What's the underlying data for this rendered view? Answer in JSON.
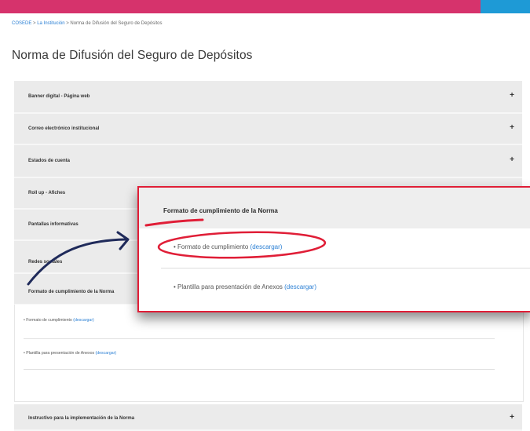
{
  "header": {
    "brand_color": "#d6336c",
    "accent_color": "#1e9ad6"
  },
  "breadcrumb": {
    "home": "COSEDE",
    "sep1": " > ",
    "section": "La Institución",
    "sep2": " > ",
    "current": "Norma de Difusión del Seguro de Depósitos"
  },
  "page_title": "Norma de Difusión del Seguro de Depósitos",
  "accordion": {
    "items": [
      {
        "label": "Banner digital - Página web",
        "icon": "+"
      },
      {
        "label": "Correo electrónico institucional",
        "icon": "+"
      },
      {
        "label": "Estados de cuenta",
        "icon": "+"
      },
      {
        "label": "Roll up - Afiches"
      },
      {
        "label": "Pantallas informativas"
      },
      {
        "label": "Redes sociales"
      },
      {
        "label": "Formato de cumplimiento de la Norma"
      },
      {
        "label": "Instructivo para la implementación de la Norma",
        "icon": "+"
      }
    ],
    "open_item": {
      "rows": [
        {
          "text": "Formato de cumplimiento",
          "link": "(descargar)"
        },
        {
          "text": "Plantilla para presentación de Anexos",
          "link": "(descargar)"
        }
      ]
    }
  },
  "callout": {
    "title": "Formato de cumplimiento de la Norma",
    "rows": [
      {
        "text": "Formato de cumplimiento",
        "link": "(descargar)"
      },
      {
        "text": "Plantilla para presentación de Anexos",
        "link": "(descargar)"
      }
    ]
  },
  "annotation": {
    "highlight_color": "#e01e37",
    "arrow_color": "#1f2a5a"
  }
}
